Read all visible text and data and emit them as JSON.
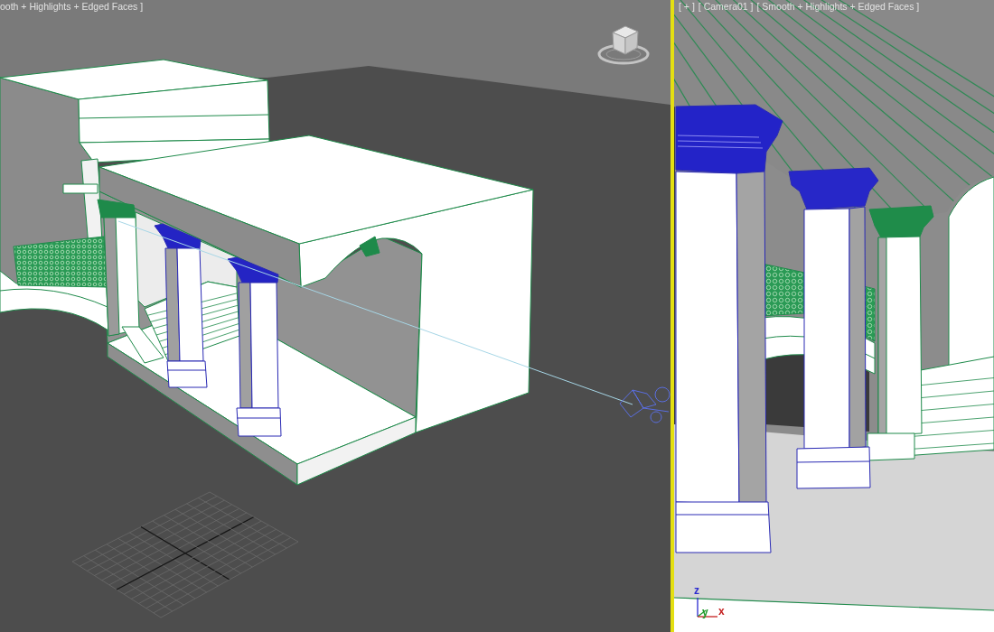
{
  "viewports": [
    {
      "kind": "perspective",
      "active": false,
      "labels": [
        "ooth + Highlights + Edged Faces ]"
      ]
    },
    {
      "kind": "camera",
      "active": true,
      "labels": [
        "[ + ]",
        "[ Camera01 ]",
        "[ Smooth + Highlights + Edged Faces ]"
      ],
      "axes": [
        {
          "label": "z",
          "color": "#2a2ad0"
        },
        {
          "label": "y",
          "color": "#1f9a2a"
        },
        {
          "label": "x",
          "color": "#c42020"
        }
      ]
    }
  ]
}
